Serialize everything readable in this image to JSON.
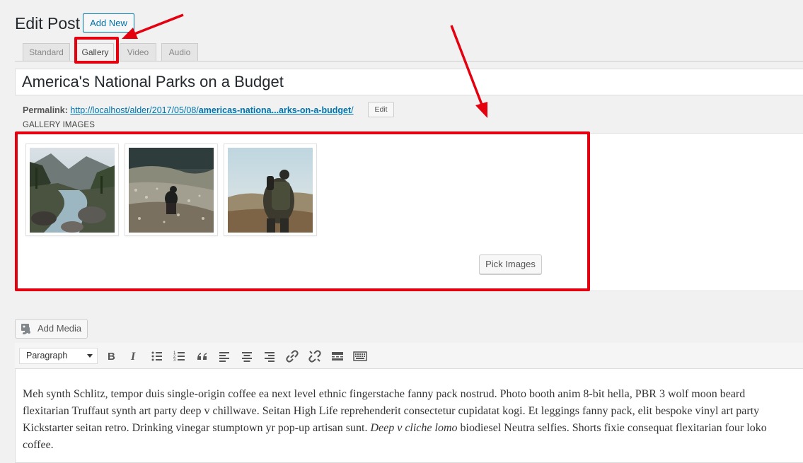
{
  "header": {
    "title": "Edit Post",
    "add_new_label": "Add New"
  },
  "format_tabs": [
    {
      "label": "Standard"
    },
    {
      "label": "Gallery"
    },
    {
      "label": "Video"
    },
    {
      "label": "Audio"
    }
  ],
  "post": {
    "title": "America's National Parks on a Budget",
    "permalink_label": "Permalink:",
    "permalink_url": "http://localhost/alder/2017/05/08/americas-nationa...arks-on-a-budget/",
    "permalink_url_base": "http://localhost/alder/2017/05/08/",
    "permalink_url_slug": "americas-nationa...arks-on-a-budget",
    "permalink_url_trail": "/",
    "edit_label": "Edit"
  },
  "gallery": {
    "section_label": "GALLERY IMAGES",
    "pick_images_label": "Pick Images",
    "images": [
      {
        "subject": "mountain river valley"
      },
      {
        "subject": "hiker in meadow"
      },
      {
        "subject": "backpacker in field"
      }
    ]
  },
  "editor": {
    "add_media_label": "Add Media",
    "format_select_value": "Paragraph",
    "toolbar_icons": [
      "bold-icon",
      "italic-icon",
      "bulleted-list-icon",
      "numbered-list-icon",
      "blockquote-icon",
      "align-left-icon",
      "align-center-icon",
      "align-right-icon",
      "insert-link-icon",
      "remove-link-icon",
      "read-more-icon",
      "toolbar-toggle-icon"
    ],
    "content_lines": [
      "Meh synth Schlitz, tempor duis single-origin coffee ea next level ethnic fingerstache fanny pack nostrud. Photo booth anim 8-bit hella, PBR 3 wolf moon beard",
      "flexitarian Truffaut synth art party deep v chillwave. Seitan High Life reprehenderit consectetur cupidatat kogi. Et leggings fanny pack, elit bespoke vinyl art party",
      "Kickstarter seitan retro. Drinking vinegar stumptown yr pop-up artisan sunt. ",
      "coffee."
    ],
    "content_line3_italic": "Deep v cliche lomo",
    "content_line3_rest": " biodiesel Neutra selfies. Shorts fixie consequat flexitarian four loko"
  },
  "colors": {
    "link": "#0073aa",
    "annotation": "#e4000f",
    "background": "#f1f1f1"
  }
}
